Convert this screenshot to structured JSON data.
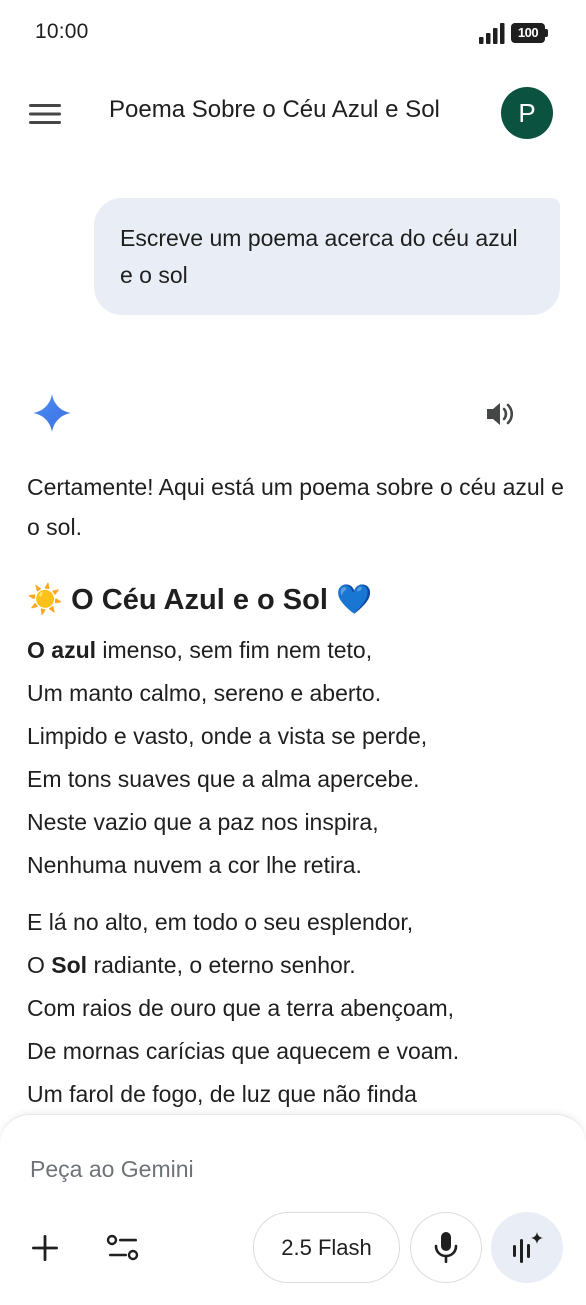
{
  "status_bar": {
    "time": "10:00",
    "battery": "100",
    "icons": [
      "signal-icon",
      "battery-icon"
    ]
  },
  "header": {
    "menu_icon": "hamburger-menu-icon",
    "title": "Poema Sobre o Céu Azul e Sol",
    "avatar_letter": "P",
    "avatar_color": "#0b5240"
  },
  "conversation": {
    "user_message": "Escreve um poema acerca do céu azul e o sol",
    "user_bubble_color": "#e9eef6",
    "response": {
      "logo_icon": "gemini-sparkle-icon",
      "speaker_icon": "volume-icon",
      "intro": "Certamente! Aqui está um poema sobre o céu azul e o sol.",
      "poem_title_emoji_left": "☀️",
      "poem_title": "O Céu Azul e o Sol",
      "poem_title_emoji_right": "💙",
      "stanza1": {
        "line1_bold": "O azul",
        "line1_rest": " imenso, sem fim nem teto,",
        "line2": "Um manto calmo, sereno e aberto.",
        "line3": "Limpido e vasto, onde a vista se perde,",
        "line4": "Em tons suaves que a alma apercebe.",
        "line5": "Neste vazio que a paz nos inspira,",
        "line6": "Nenhuma nuvem a cor lhe retira."
      },
      "stanza2": {
        "line1": "E lá no alto, em todo o seu esplendor,",
        "line2_pre": "O ",
        "line2_bold": "Sol",
        "line2_rest": " radiante, o eterno senhor.",
        "line3": "Com raios de ouro que a terra abençoam,",
        "line4": "De mornas carícias que aquecem e voam.",
        "line5": "Um farol de fogo, de luz que não finda"
      }
    }
  },
  "composer": {
    "placeholder": "Peça ao Gemini",
    "add_icon": "plus-icon",
    "tools_icon": "tools-sliders-icon",
    "model_label": "2.5 Flash",
    "mic_icon": "microphone-icon",
    "live_icon": "gemini-live-icon"
  }
}
